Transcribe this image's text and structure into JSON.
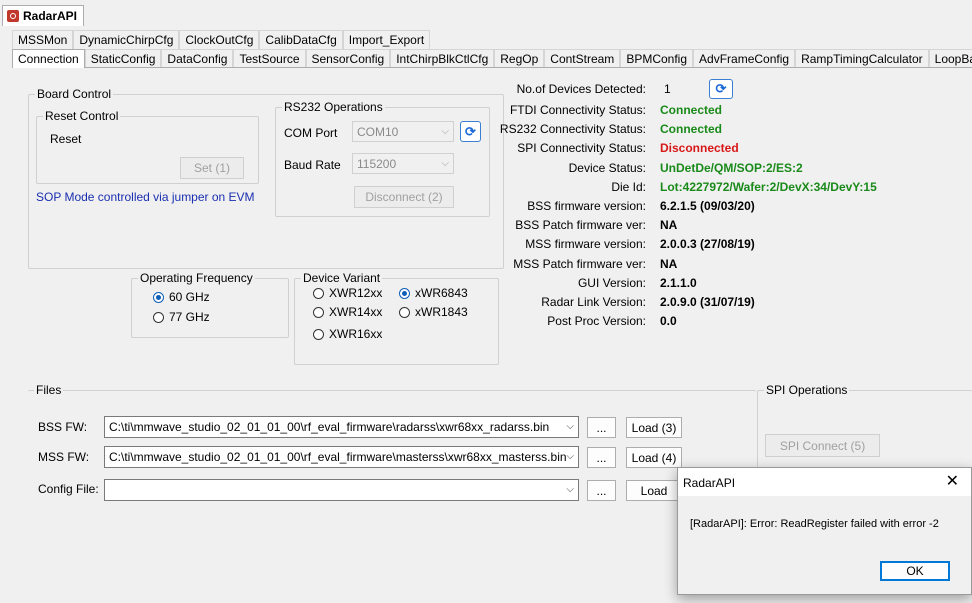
{
  "app": {
    "tab_title": "RadarAPI"
  },
  "tabs_row1": [
    "MSSMon",
    "DynamicChirpCfg",
    "ClockOutCfg",
    "CalibDataCfg",
    "Import_Export"
  ],
  "tabs_row2": [
    "Connection",
    "StaticConfig",
    "DataConfig",
    "TestSource",
    "SensorConfig",
    "IntChirpBlkCtlCfg",
    "RegOp",
    "ContStream",
    "BPMConfig",
    "AdvFrameConfig",
    "RampTimingCalculator",
    "LoopBack"
  ],
  "board_control": {
    "title": "Board Control",
    "reset_control": {
      "title": "Reset Control",
      "label": "Reset",
      "set_button": "Set (1)"
    },
    "sop_note": "SOP Mode controlled via jumper on EVM",
    "rs232": {
      "title": "RS232 Operations",
      "com_port_label": "COM Port",
      "com_port_value": "COM10",
      "baud_rate_label": "Baud Rate",
      "baud_rate_value": "115200",
      "disconnect_button": "Disconnect (2)"
    }
  },
  "operating_frequency": {
    "title": "Operating Frequency",
    "options": [
      "60 GHz",
      "77 GHz"
    ],
    "selected": "60 GHz"
  },
  "device_variant": {
    "title": "Device Variant",
    "options": [
      "XWR12xx",
      "xWR6843",
      "XWR14xx",
      "xWR1843",
      "XWR16xx"
    ],
    "selected": "xWR6843"
  },
  "status": {
    "devices_label": "No.of Devices Detected:",
    "devices_value": "1",
    "rows": [
      {
        "key": "FTDI Connectivity Status:",
        "value": "Connected",
        "color": "#1a8a1a"
      },
      {
        "key": "RS232 Connectivity Status:",
        "value": "Connected",
        "color": "#1a8a1a"
      },
      {
        "key": "SPI Connectivity Status:",
        "value": "Disconnected",
        "color": "#d81818"
      },
      {
        "key": "Device Status:",
        "value": "UnDetDe/QM/SOP:2/ES:2",
        "color": "#1a8a1a"
      },
      {
        "key": "Die Id:",
        "value": "Lot:4227972/Wafer:2/DevX:34/DevY:15",
        "color": "#1a8a1a"
      },
      {
        "key": "BSS firmware version:",
        "value": "6.2.1.5 (09/03/20)",
        "color": "#000000"
      },
      {
        "key": "BSS Patch firmware ver:",
        "value": "NA",
        "color": "#000000"
      },
      {
        "key": "MSS firmware version:",
        "value": "2.0.0.3 (27/08/19)",
        "color": "#000000"
      },
      {
        "key": "MSS Patch firmware ver:",
        "value": "NA",
        "color": "#000000"
      },
      {
        "key": "GUI Version:",
        "value": "2.1.1.0",
        "color": "#000000"
      },
      {
        "key": "Radar Link Version:",
        "value": "2.0.9.0 (31/07/19)",
        "color": "#000000"
      },
      {
        "key": "Post Proc Version:",
        "value": "0.0",
        "color": "#000000"
      }
    ]
  },
  "files": {
    "title": "Files",
    "bss_label": "BSS FW:",
    "bss_path": "C:\\ti\\mmwave_studio_02_01_01_00\\rf_eval_firmware\\radarss\\xwr68xx_radarss.bin",
    "bss_load": "Load (3)",
    "mss_label": "MSS FW:",
    "mss_path": "C:\\ti\\mmwave_studio_02_01_01_00\\rf_eval_firmware\\masterss\\xwr68xx_masterss.bin",
    "mss_load": "Load (4)",
    "config_label": "Config File:",
    "config_path": "",
    "config_load": "Load",
    "browse": "..."
  },
  "spi": {
    "title": "SPI Operations",
    "connect_button": "SPI Connect (5)"
  },
  "dialog": {
    "title": "RadarAPI",
    "message": "[RadarAPI]: Error: ReadRegister failed with error -2",
    "ok_button": "OK"
  }
}
